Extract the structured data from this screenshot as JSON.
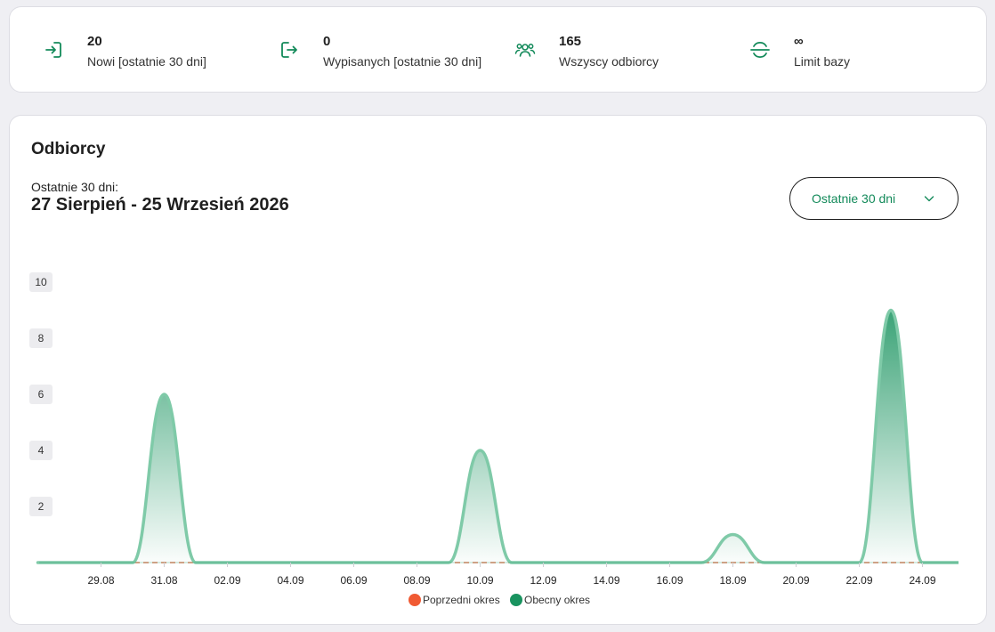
{
  "stats": [
    {
      "value": "20",
      "label": "Nowi [ostatnie 30 dni]",
      "icon": "login-arrow-icon"
    },
    {
      "value": "0",
      "label": "Wypisanych [ostatnie 30 dni]",
      "icon": "logout-arrow-icon"
    },
    {
      "value": "165",
      "label": "Wszyscy odbiorcy",
      "icon": "users-group-icon"
    },
    {
      "value": "∞",
      "label": "Limit bazy",
      "icon": "database-limit-icon"
    }
  ],
  "chart_card": {
    "title": "Odbiorcy",
    "period_label": "Ostatnie 30 dni:",
    "period_range": "27 Sierpień - 25 Wrzesień 2026",
    "dropdown": {
      "selected": "Ostatnie 30 dni",
      "icon": "chevron-down-icon"
    }
  },
  "colors": {
    "accent": "#138a5a",
    "current_line": "#7fcaa8",
    "current_fill": "#19935f",
    "previous": "#f05a33"
  },
  "chart_data": {
    "type": "area",
    "x": [
      "27.08",
      "28.08",
      "29.08",
      "30.08",
      "31.08",
      "01.09",
      "02.09",
      "03.09",
      "04.09",
      "05.09",
      "06.09",
      "07.09",
      "08.09",
      "09.09",
      "10.09",
      "11.09",
      "12.09",
      "13.09",
      "14.09",
      "15.09",
      "16.09",
      "17.09",
      "18.09",
      "19.09",
      "20.09",
      "21.09",
      "22.09",
      "23.09",
      "24.09",
      "25.09"
    ],
    "x_tick_labels": [
      "29.08",
      "31.08",
      "02.09",
      "04.09",
      "06.09",
      "08.09",
      "10.09",
      "12.09",
      "14.09",
      "16.09",
      "18.09",
      "20.09",
      "22.09",
      "24.09"
    ],
    "series": [
      {
        "name": "Poprzedni okres",
        "color": "#f05a33",
        "style": "dashed",
        "values": [
          0,
          0,
          0,
          0,
          0,
          0,
          0,
          0,
          0,
          0,
          0,
          0,
          0,
          0,
          0,
          0,
          0,
          0,
          0,
          0,
          0,
          0,
          0,
          0,
          0,
          0,
          0,
          0,
          0,
          0
        ]
      },
      {
        "name": "Obecny okres",
        "color": "#19935f",
        "style": "area",
        "values": [
          0,
          0,
          0,
          0,
          6,
          0,
          0,
          0,
          0,
          0,
          0,
          0,
          0,
          0,
          4,
          0,
          0,
          0,
          0,
          0,
          0,
          0,
          1,
          0,
          0,
          0,
          0,
          9,
          0,
          0
        ]
      }
    ],
    "y_ticks": [
      2,
      4,
      6,
      8,
      10
    ],
    "ylim": [
      0,
      10
    ],
    "grid": false,
    "legend_position": "bottom-center"
  }
}
